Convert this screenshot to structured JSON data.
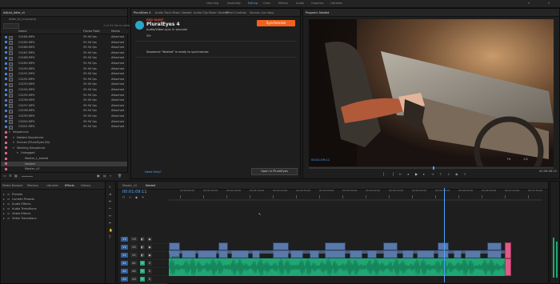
{
  "workspaces": [
    "Learning",
    "Assembly",
    "Editing",
    "Color",
    "Effects",
    "Audio",
    "Graphics",
    "Libraries"
  ],
  "workspace_active": 2,
  "project": {
    "title": "Adjust_Adler_ct",
    "search_placeholder": "",
    "path": "Adler_Ki_cut.prproj",
    "col_name": "Name",
    "col_framerate": "Frame Rate",
    "col_media": "Media",
    "items_label": "1 of 54 items selected",
    "clips": [
      {
        "name": "C0184.MP4",
        "fps": "59.94 fps",
        "media": "Attached"
      },
      {
        "name": "C0185.MP4",
        "fps": "59.94 fps",
        "media": "Attached"
      },
      {
        "name": "C0186.MP4",
        "fps": "59.94 fps",
        "media": "Attached"
      },
      {
        "name": "C0187.MP4",
        "fps": "59.94 fps",
        "media": "Attached"
      },
      {
        "name": "C0188.MP4",
        "fps": "59.94 fps",
        "media": "Attached"
      },
      {
        "name": "C0189.MP4",
        "fps": "59.94 fps",
        "media": "Attached"
      },
      {
        "name": "C0190.MP4",
        "fps": "59.94 fps",
        "media": "Attached"
      },
      {
        "name": "C0191.MP4",
        "fps": "59.94 fps",
        "media": "Attached"
      },
      {
        "name": "C0192.MP4",
        "fps": "59.94 fps",
        "media": "Attached"
      },
      {
        "name": "C0193.MP4",
        "fps": "59.94 fps",
        "media": "Attached"
      },
      {
        "name": "C0194.MP4",
        "fps": "59.94 fps",
        "media": "Attached"
      },
      {
        "name": "C0195.MP4",
        "fps": "59.94 fps",
        "media": "Attached"
      },
      {
        "name": "C0196.MP4",
        "fps": "59.94 fps",
        "media": "Attached"
      },
      {
        "name": "C0197.MP4",
        "fps": "59.94 fps",
        "media": "Attached"
      },
      {
        "name": "C0198.MP4",
        "fps": "59.94 fps",
        "media": "Attached"
      },
      {
        "name": "C0199.MP4",
        "fps": "59.94 fps",
        "media": "Attached"
      },
      {
        "name": "C0200.MP4",
        "fps": "59.94 fps",
        "media": "Attached"
      },
      {
        "name": "C0201.MP4",
        "fps": "59.94 fps",
        "media": "Attached"
      }
    ],
    "tree": [
      {
        "name": "Sequences",
        "indent": 0
      },
      {
        "name": "Nested Sequences",
        "indent": 1
      },
      {
        "name": "Scenes (PluralEyes Kit)",
        "indent": 1
      },
      {
        "name": "Working Sequences",
        "indent": 1
      },
      {
        "name": "Untagged",
        "indent": 2
      },
      {
        "name": "Master_L_tested",
        "indent": 3
      },
      {
        "name": "Nested",
        "indent": 3
      },
      {
        "name": "Master_v2",
        "indent": 3
      },
      {
        "name": "Master_v3",
        "indent": 3
      }
    ],
    "selected_tree_index": 6
  },
  "effects_panel": {
    "tabs": [
      "Media Browser",
      "Markers",
      "Libraries",
      "Effects",
      "History"
    ],
    "active_tab": 3,
    "items": [
      "Presets",
      "Lumetri Presets",
      "Audio Effects",
      "Audio Transitions",
      "Video Effects",
      "Video Transitions"
    ]
  },
  "plugin_panel": {
    "tabs": [
      "PluralEyes 4",
      "Audio Track Mixer: Nested",
      "Audio Clip Mixer: Nested",
      "Effect Controls",
      "Source: (no clips)"
    ],
    "active_tab": 0,
    "brand_small": "RED GIANT",
    "brand_title": "PluralEyes 4",
    "brand_sub": "Audio/Video sync in seconds",
    "sync_button": "Synchronize",
    "status_message": "Sequence \"Nested\" is ready to synchronize",
    "help_link": "Need Help?",
    "open_button": "Open in PluralEyes"
  },
  "program_monitor": {
    "tab": "Program: Nested",
    "timecode_left": "00:01:09:11",
    "zoom": "Fit",
    "quality": "1/4",
    "timecode_right": "00:06:08:10"
  },
  "timeline": {
    "tabs": [
      "Master_v3",
      "Nested"
    ],
    "active_tab": 1,
    "timecode": "00:01:09:11",
    "ruler": [
      "00:00:00:00",
      "00:00:30:00",
      "00:01:00:00",
      "00:01:30:00",
      "00:02:00:00",
      "00:02:30:00",
      "00:03:00:00",
      "00:03:30:00",
      "00:04:00:00",
      "00:04:30:00",
      "00:05:00:00",
      "00:05:30:00",
      "00:06:00:00",
      "00:06:30:00",
      "00:07:00:00",
      "00:07:30:00"
    ],
    "video_tracks": [
      "V3",
      "V2",
      "V1"
    ],
    "audio_tracks": [
      "A1",
      "A2",
      "A3"
    ],
    "clip_label": "Nested"
  },
  "colors": {
    "accent_blue": "#4aa3ff",
    "sync_orange": "#f2611d",
    "video_clip": "#5a78a8",
    "audio_clip": "#1fa774",
    "label_pink": "#e05a87",
    "folder_pink": "#d8648a"
  }
}
